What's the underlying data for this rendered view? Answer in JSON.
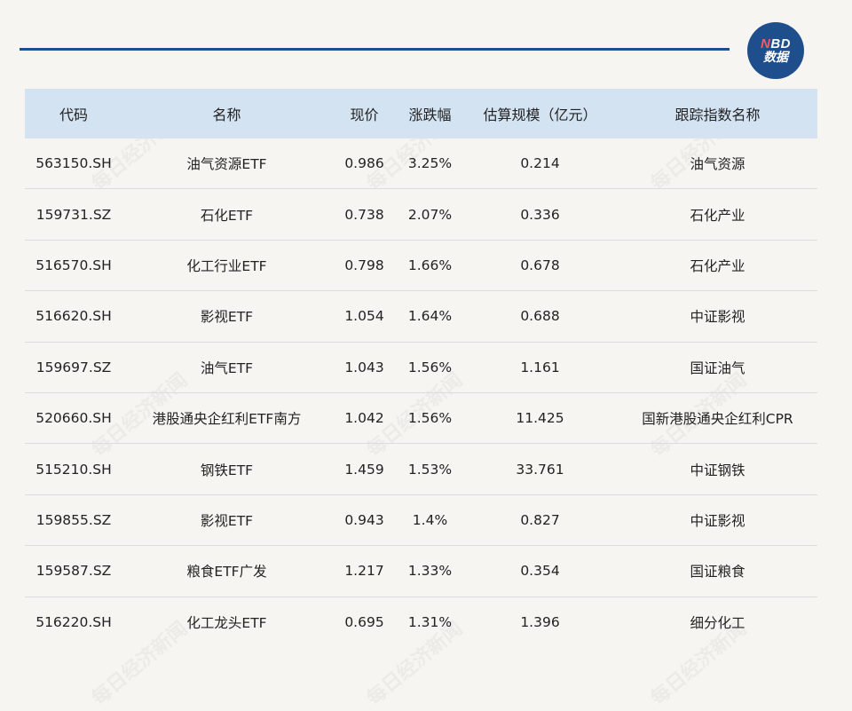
{
  "logo": {
    "line1_n": "N",
    "line1_rest": "BD",
    "line2": "数据"
  },
  "watermark": "每日经济新闻",
  "table": {
    "headers": [
      "代码",
      "名称",
      "现价",
      "涨跌幅",
      "估算规模（亿元）",
      "跟踪指数名称"
    ],
    "rows": [
      [
        "563150.SH",
        "油气资源ETF",
        "0.986",
        "3.25%",
        "0.214",
        "油气资源"
      ],
      [
        "159731.SZ",
        "石化ETF",
        "0.738",
        "2.07%",
        "0.336",
        "石化产业"
      ],
      [
        "516570.SH",
        "化工行业ETF",
        "0.798",
        "1.66%",
        "0.678",
        "石化产业"
      ],
      [
        "516620.SH",
        "影视ETF",
        "1.054",
        "1.64%",
        "0.688",
        "中证影视"
      ],
      [
        "159697.SZ",
        "油气ETF",
        "1.043",
        "1.56%",
        "1.161",
        "国证油气"
      ],
      [
        "520660.SH",
        "港股通央企红利ETF南方",
        "1.042",
        "1.56%",
        "11.425",
        "国新港股通央企红利CPR"
      ],
      [
        "515210.SH",
        "钢铁ETF",
        "1.459",
        "1.53%",
        "33.761",
        "中证钢铁"
      ],
      [
        "159855.SZ",
        "影视ETF",
        "0.943",
        "1.4%",
        "0.827",
        "中证影视"
      ],
      [
        "159587.SZ",
        "粮食ETF广发",
        "1.217",
        "1.33%",
        "0.354",
        "国证粮食"
      ],
      [
        "516220.SH",
        "化工龙头ETF",
        "0.695",
        "1.31%",
        "1.396",
        "细分化工"
      ]
    ]
  }
}
